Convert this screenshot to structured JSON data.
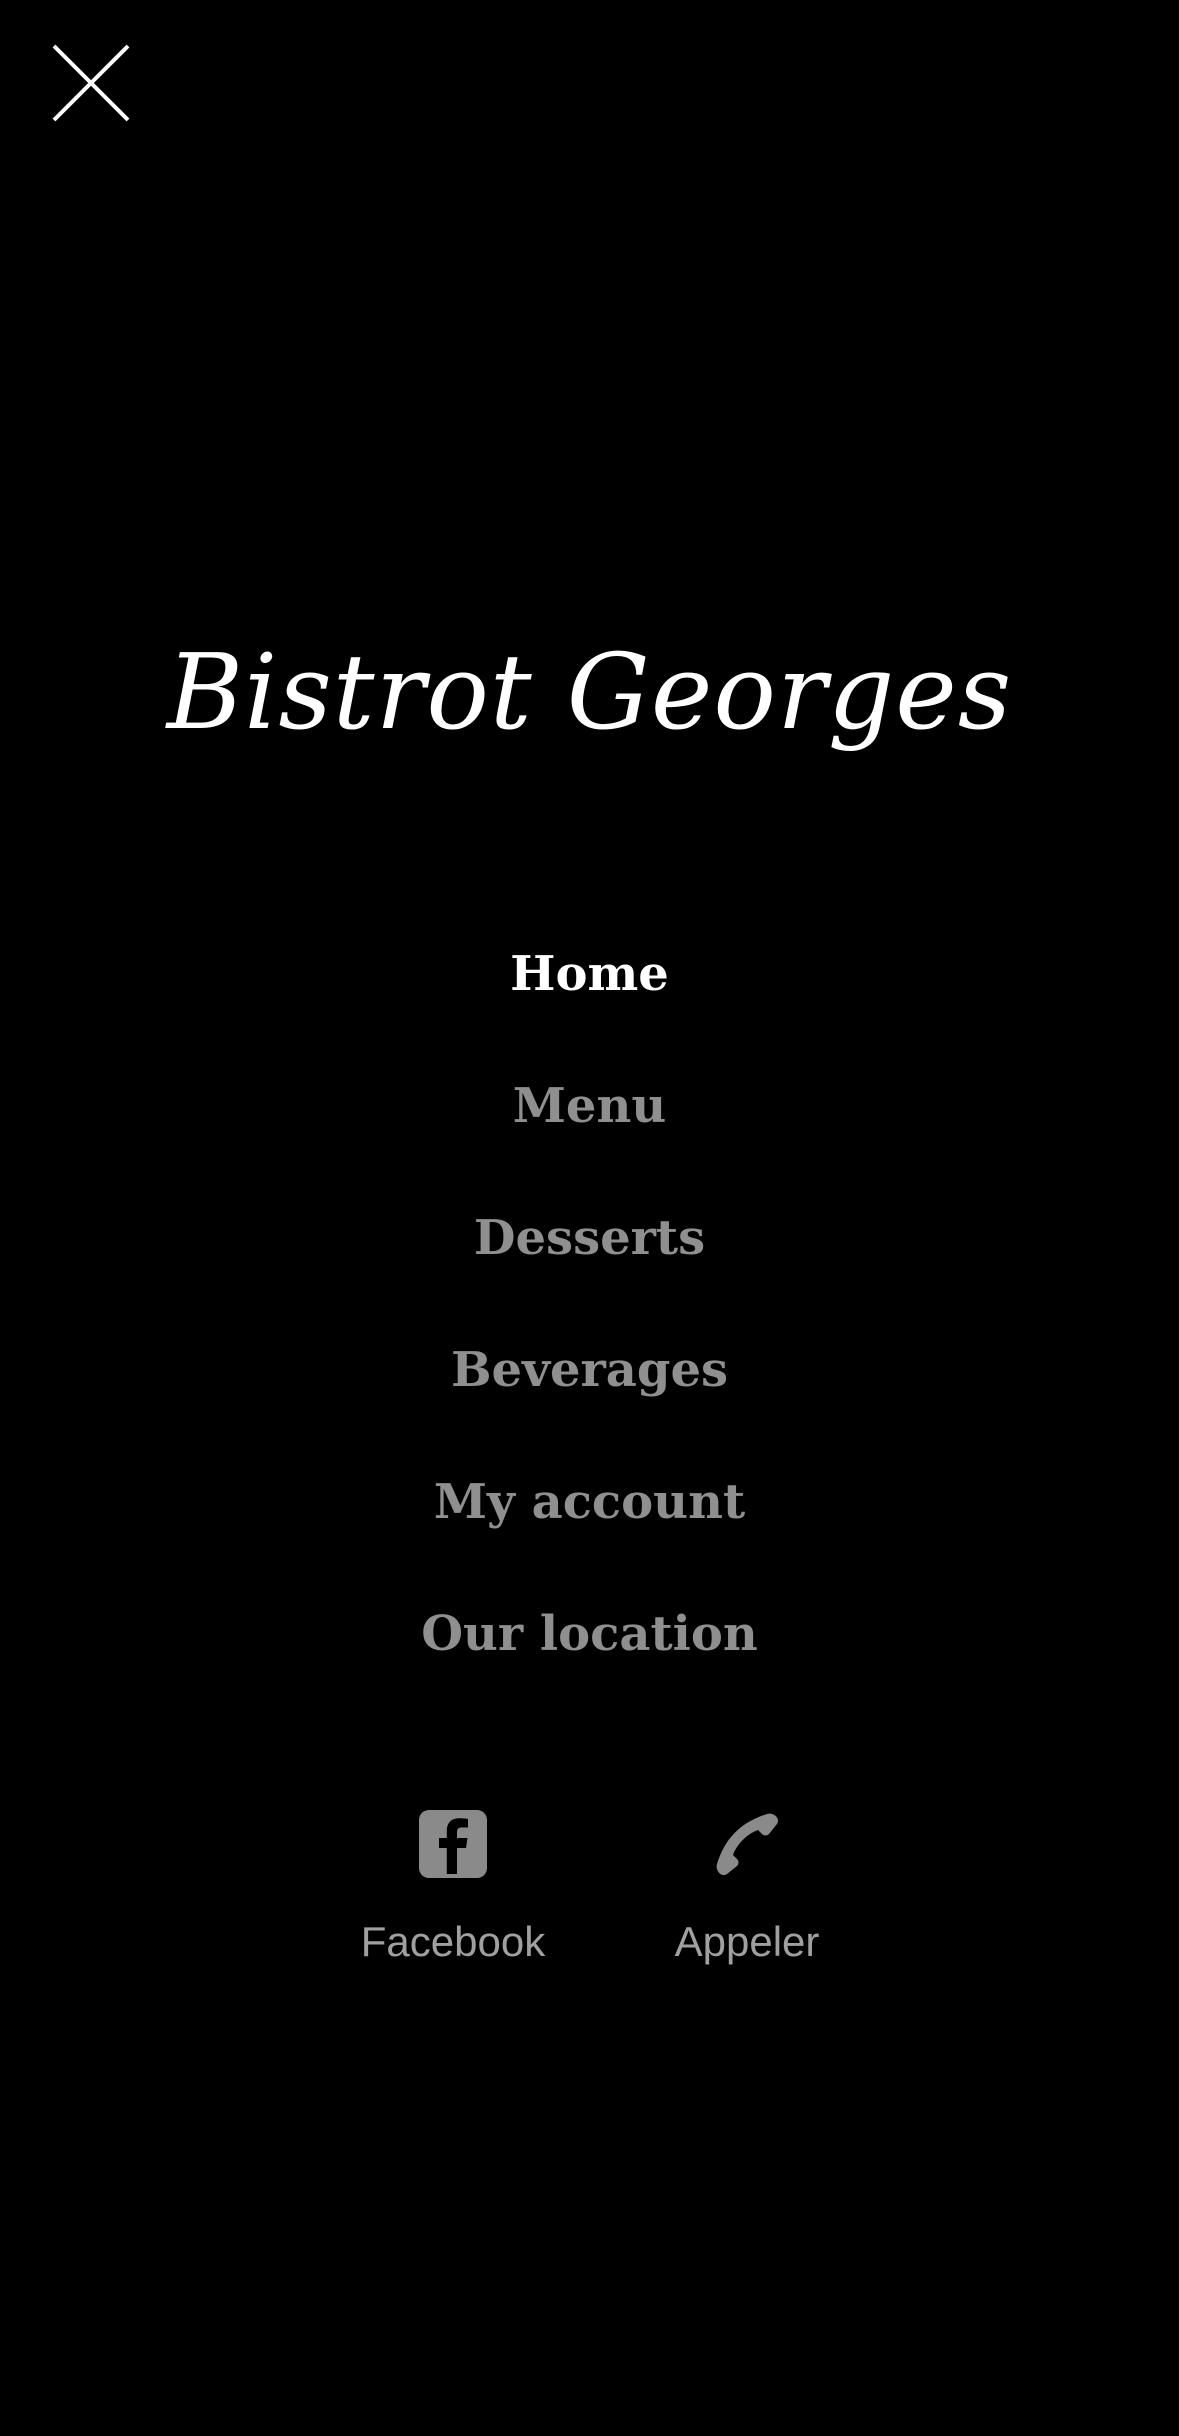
{
  "brand": {
    "name": "Bistrot Georges"
  },
  "nav": {
    "items": [
      {
        "label": "Home",
        "active": true
      },
      {
        "label": "Menu",
        "active": false
      },
      {
        "label": "Desserts",
        "active": false
      },
      {
        "label": "Beverages",
        "active": false
      },
      {
        "label": "My account",
        "active": false
      },
      {
        "label": "Our location",
        "active": false
      }
    ]
  },
  "actions": {
    "facebook": {
      "label": "Facebook",
      "icon": "facebook-icon"
    },
    "call": {
      "label": "Appeler",
      "icon": "phone-icon"
    }
  },
  "colors": {
    "background": "#000000",
    "active_text": "#ffffff",
    "inactive_text": "#8f8f8f",
    "icon": "#8a8a8a"
  }
}
